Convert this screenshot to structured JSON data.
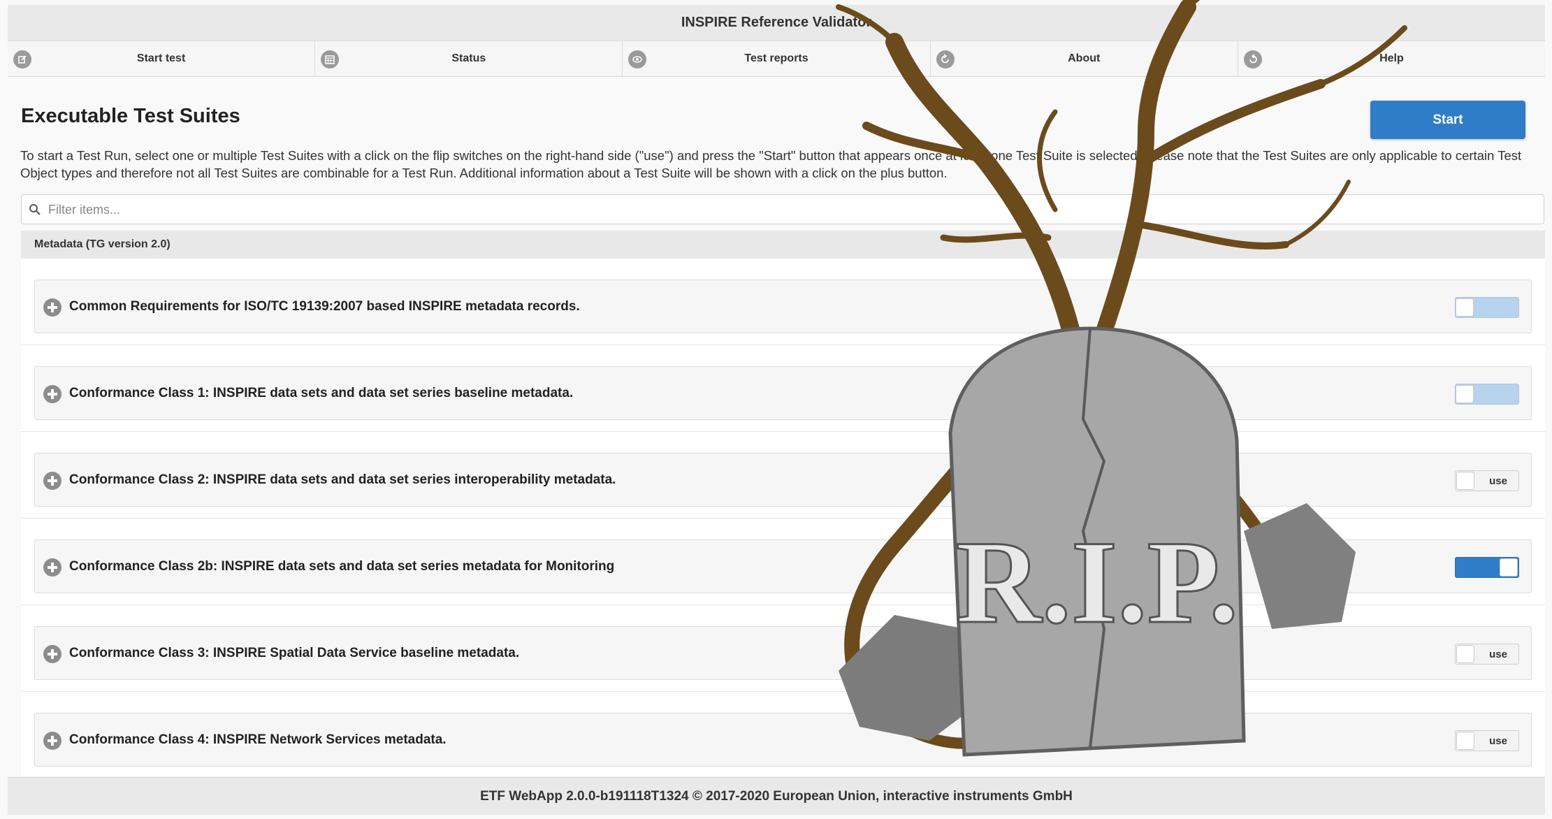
{
  "app": {
    "title": "INSPIRE Reference Validator"
  },
  "nav": [
    {
      "label": "Start test",
      "icon": "edit-icon"
    },
    {
      "label": "Status",
      "icon": "calendar-icon"
    },
    {
      "label": "Test reports",
      "icon": "eye-icon"
    },
    {
      "label": "About",
      "icon": "back-arrow-icon"
    },
    {
      "label": "Help",
      "icon": "refresh-icon"
    }
  ],
  "main": {
    "heading": "Executable Test Suites",
    "start_label": "Start",
    "intro": "To start a Test Run, select one or multiple Test Suites with a click on the flip switches on the right-hand side (\"use\") and press the \"Start\" button that appears once at least one Test Suite is selected. Please note that the Test Suites are only applicable to certain Test Object types and therefore not all Test Suites are combinable for a Test Run. Additional information about a Test Suite will be shown with a click on the plus button.",
    "filter_placeholder": "Filter items...",
    "group": "Metadata (TG version 2.0)",
    "switch_label": "use"
  },
  "test_suites": [
    {
      "title": "Common Requirements for ISO/TC 19139:2007 based INSPIRE metadata records.",
      "state": "dim"
    },
    {
      "title": "Conformance Class 1: INSPIRE data sets and data set series baseline metadata.",
      "state": "dim"
    },
    {
      "title": "Conformance Class 2: INSPIRE data sets and data set series interoperability metadata.",
      "state": "off"
    },
    {
      "title": "Conformance Class 2b: INSPIRE data sets and data set series metadata for Monitoring",
      "state": "on"
    },
    {
      "title": "Conformance Class 3: INSPIRE Spatial Data Service baseline metadata.",
      "state": "off"
    },
    {
      "title": "Conformance Class 4: INSPIRE Network Services metadata.",
      "state": "off"
    }
  ],
  "footer": {
    "text": "ETF WebApp 2.0.0-b191118T1324 © 2017-2020 European Union, interactive instruments GmbH"
  },
  "overlay": {
    "stone_text": "R.I.P."
  }
}
